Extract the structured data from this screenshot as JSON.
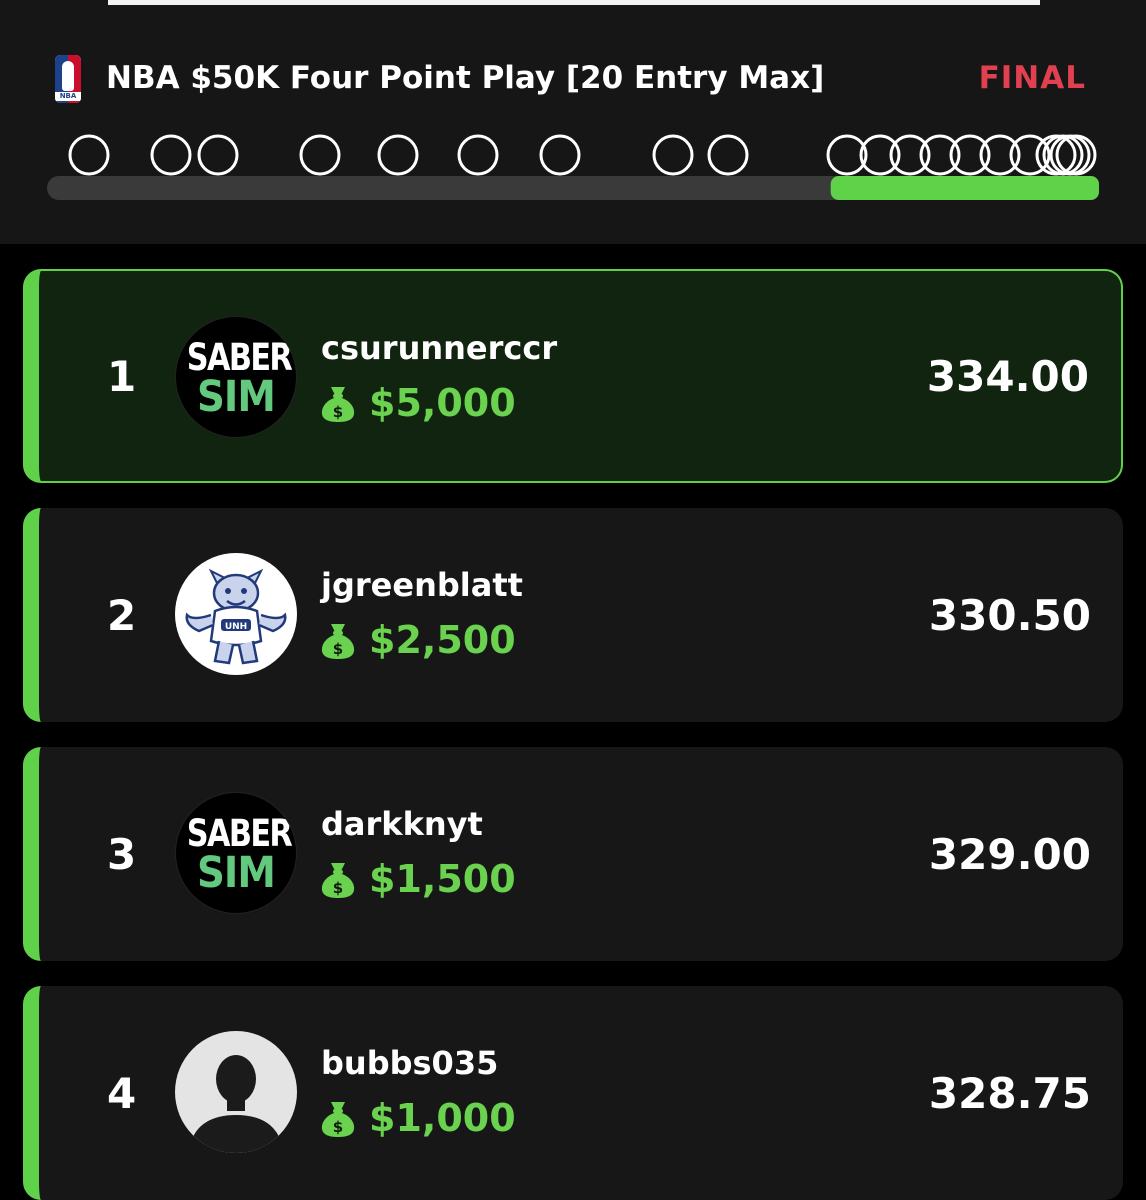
{
  "contest": {
    "league_icon": "nba-logo-icon",
    "title": "NBA $50K Four Point Play [20 Entry Max]",
    "status": "FINAL"
  },
  "progress": {
    "completed_fraction": 0.745,
    "track_color": "#3a3a3a",
    "fill_color": "#5fd24a"
  },
  "colors": {
    "accent": "#5fd24a",
    "prize": "#6ad24f",
    "status_final": "#e0404f",
    "first_card_bg": "#112410"
  },
  "leaderboard": [
    {
      "rank": "1",
      "username": "csurunnerccr",
      "prize": "$5,000",
      "score": "334.00",
      "avatar": "sabersim-logo"
    },
    {
      "rank": "2",
      "username": "jgreenblatt",
      "prize": "$2,500",
      "score": "330.50",
      "avatar": "wildcat-mascot"
    },
    {
      "rank": "3",
      "username": "darkknyt",
      "prize": "$1,500",
      "score": "329.00",
      "avatar": "sabersim-logo"
    },
    {
      "rank": "4",
      "username": "bubbs035",
      "prize": "$1,000",
      "score": "328.75",
      "avatar": "default-user-silhouette"
    }
  ],
  "avatar_text": {
    "saber_top": "SABER",
    "saber_bottom": "SIM",
    "mascot_badge": "UNH"
  }
}
